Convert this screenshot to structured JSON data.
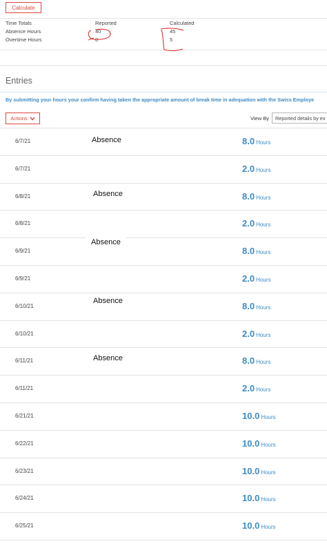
{
  "toolbar": {
    "calculate_label": "Calculate"
  },
  "totals": {
    "header": [
      "Time Totals",
      "Reported",
      "Calculated"
    ],
    "rows": [
      {
        "label": "Absence Hours",
        "reported": "40",
        "calculated": "45"
      },
      {
        "label": "Overtime Hours",
        "reported": "0",
        "calculated": "5"
      }
    ]
  },
  "entries": {
    "title": "Entries",
    "notice": "By submitting your hours your confirm having taken the appropriate amount of break time in adequation with the Swiss Employe",
    "actions_label": "Actions",
    "view_by_label": "View By",
    "view_by_value": "Reported details by ex",
    "rows": [
      {
        "date": "6/7/21",
        "value": "8.0",
        "unit": "Hours"
      },
      {
        "date": "6/7/21",
        "value": "2.0",
        "unit": "Hours"
      },
      {
        "date": "6/8/21",
        "value": "8.0",
        "unit": "Hours"
      },
      {
        "date": "6/8/21",
        "value": "2.0",
        "unit": "Hours"
      },
      {
        "date": "6/9/21",
        "value": "8.0",
        "unit": "Hours"
      },
      {
        "date": "6/9/21",
        "value": "2.0",
        "unit": "Hours"
      },
      {
        "date": "6/10/21",
        "value": "8.0",
        "unit": "Hours"
      },
      {
        "date": "6/10/21",
        "value": "2.0",
        "unit": "Hours"
      },
      {
        "date": "6/11/21",
        "value": "8.0",
        "unit": "Hours"
      },
      {
        "date": "6/11/21",
        "value": "2.0",
        "unit": "Hours"
      },
      {
        "date": "6/21/21",
        "value": "10.0",
        "unit": "Hours"
      },
      {
        "date": "6/22/21",
        "value": "10.0",
        "unit": "Hours"
      },
      {
        "date": "6/23/21",
        "value": "10.0",
        "unit": "Hours"
      },
      {
        "date": "6/24/21",
        "value": "10.0",
        "unit": "Hours"
      },
      {
        "date": "6/25/21",
        "value": "10.0",
        "unit": "Hours"
      }
    ]
  },
  "annotations": {
    "absence_labels": [
      "Absence",
      "Absence",
      "Absence",
      "Absence",
      "Absence"
    ]
  },
  "colors": {
    "accent_red": "#d6473c",
    "link_blue": "#3e8bc5"
  }
}
